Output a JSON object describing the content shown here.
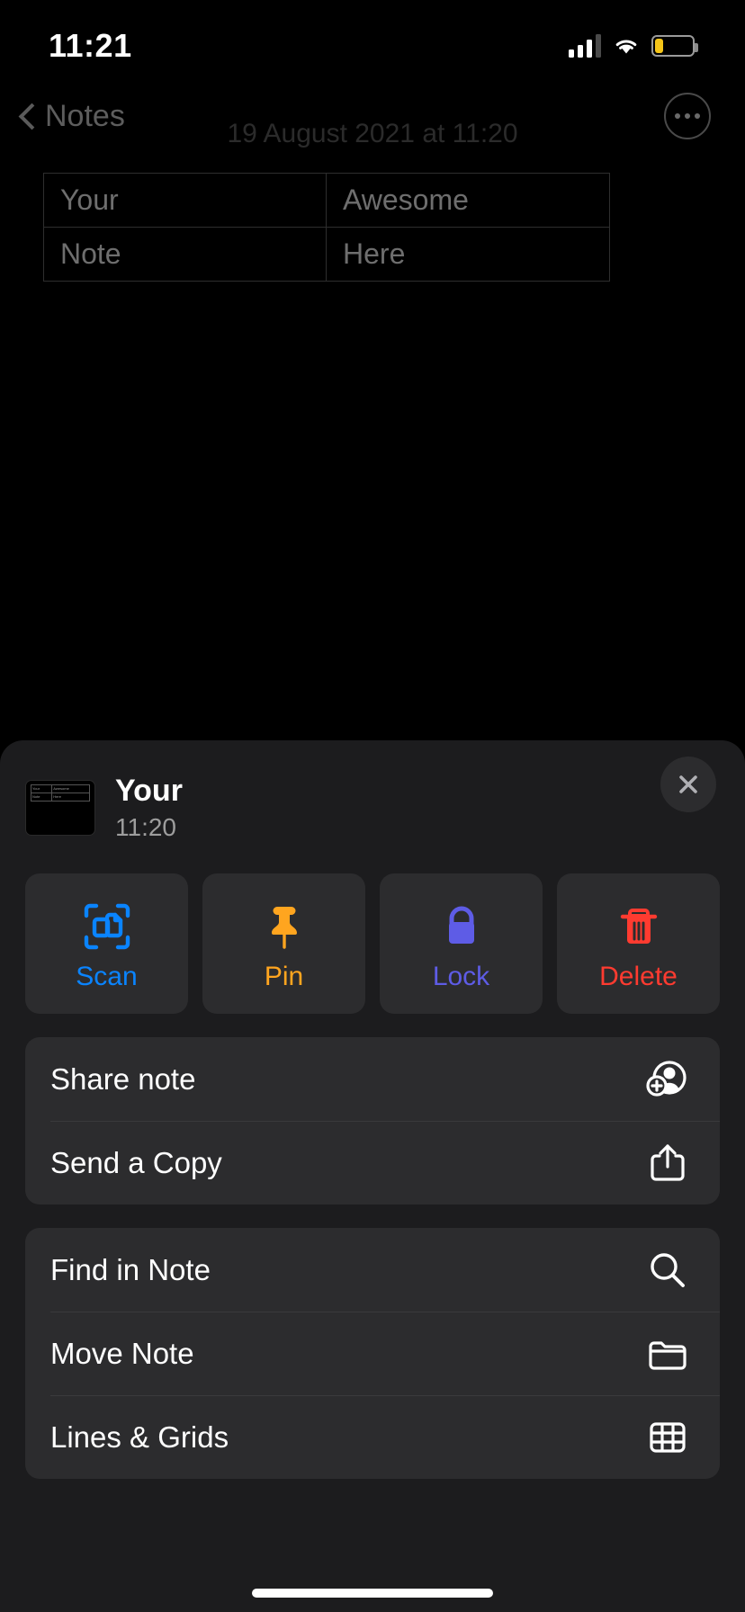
{
  "status_bar": {
    "time": "11:21",
    "signal_icon": "cellular-signal-icon",
    "wifi_icon": "wifi-icon",
    "battery_icon": "battery-low-icon",
    "battery_color": "#f5c518"
  },
  "nav": {
    "back_label": "Notes",
    "back_icon": "chevron-left-icon",
    "more_icon": "ellipsis-circle-icon"
  },
  "note": {
    "date": "19 August 2021 at 11:20",
    "table": [
      [
        "Your",
        "Awesome"
      ],
      [
        "Note",
        "Here"
      ]
    ]
  },
  "sheet": {
    "title": "Your",
    "subtitle": "11:20",
    "close_icon": "close-icon",
    "thumbnail_icon": "note-thumbnail",
    "thumbnail_table": [
      [
        "Your",
        "Awesome"
      ],
      [
        "Note",
        "Here"
      ]
    ],
    "tiles": [
      {
        "label": "Scan",
        "icon": "scan-document-icon",
        "color": "#0a84ff"
      },
      {
        "label": "Pin",
        "icon": "pin-icon",
        "color": "#ffa51f"
      },
      {
        "label": "Lock",
        "icon": "lock-icon",
        "color": "#5e5ce6"
      },
      {
        "label": "Delete",
        "icon": "trash-icon",
        "color": "#ff3b30"
      }
    ],
    "groups": [
      {
        "rows": [
          {
            "label": "Share note",
            "icon": "person-add-icon"
          },
          {
            "label": "Send a Copy",
            "icon": "share-export-icon"
          }
        ]
      },
      {
        "rows": [
          {
            "label": "Find in Note",
            "icon": "search-icon"
          },
          {
            "label": "Move Note",
            "icon": "folder-icon"
          },
          {
            "label": "Lines & Grids",
            "icon": "grid-icon"
          }
        ]
      }
    ]
  }
}
